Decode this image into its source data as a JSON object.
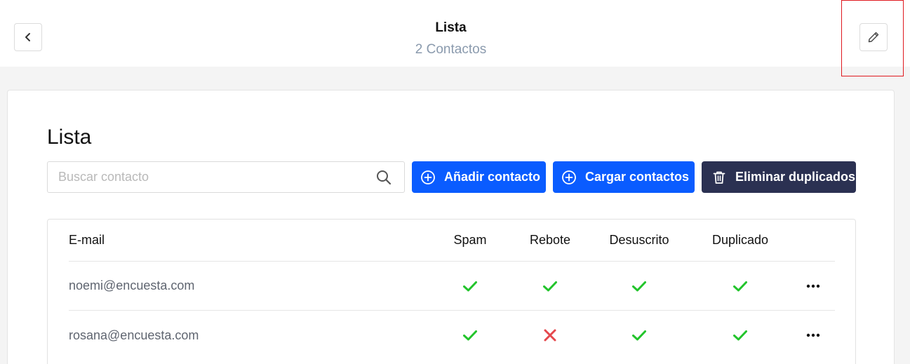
{
  "header": {
    "title": "Lista",
    "subtitle": "2 Contactos",
    "back_icon": "chevron-left-icon",
    "edit_icon": "pencil-icon"
  },
  "card": {
    "title": "Lista",
    "search_placeholder": "Buscar contacto",
    "buttons": {
      "add": "Añadir contacto",
      "upload": "Cargar contactos",
      "dedupe": "Eliminar duplicados"
    }
  },
  "table": {
    "headers": {
      "email": "E-mail",
      "spam": "Spam",
      "rebote": "Rebote",
      "desuscrito": "Desuscrito",
      "duplicado": "Duplicado"
    },
    "rows": [
      {
        "email": "noemi@encuesta.com",
        "spam": true,
        "rebote": true,
        "desuscrito": true,
        "duplicado": true
      },
      {
        "email": "rosana@encuesta.com",
        "spam": true,
        "rebote": false,
        "desuscrito": true,
        "duplicado": true
      }
    ]
  },
  "colors": {
    "primary": "#0a5cff",
    "dark": "#2b3152",
    "check": "#22c42b",
    "cross": "#e5484d",
    "highlight": "#e0191f"
  }
}
